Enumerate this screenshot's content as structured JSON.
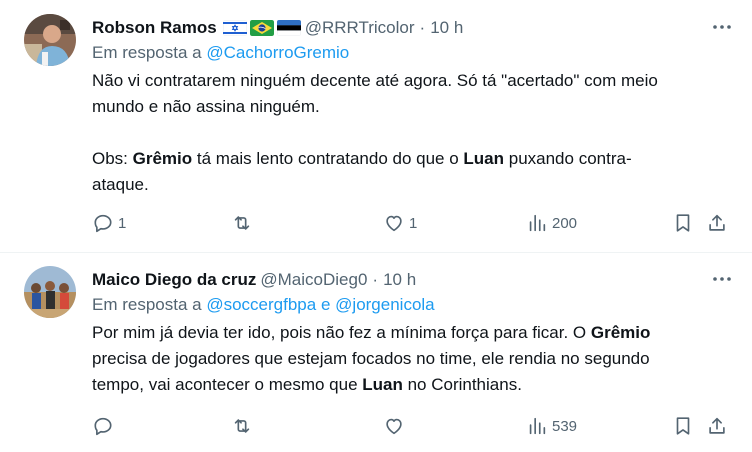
{
  "tweets": [
    {
      "author": "Robson Ramos",
      "flags": [
        "israel-flag",
        "brazil-flag",
        "estonia-flag"
      ],
      "handle": "@RRRTricolor",
      "dot": "·",
      "time": "10 h",
      "reply_prefix": "Em resposta a",
      "reply_mentions": [
        "@CachorroGremio"
      ],
      "text_p1_l1": "Não vi contratarem ninguém decente até agora. Só tá \"acertado\" com meio",
      "text_p1_l2": "mundo e não assina ninguém.",
      "text_p2_a": "Obs: ",
      "text_p2_b": "Grêmio",
      "text_p2_c": " tá mais lento contratando do que o ",
      "text_p2_d": "Luan",
      "text_p2_e": " puxando contra-",
      "text_p2_l2": "ataque.",
      "replies": "1",
      "retweets": "",
      "likes": "1",
      "views": "200"
    },
    {
      "author": "Maico Diego da cruz",
      "handle": "@MaicoDieg0",
      "dot": "·",
      "time": "10 h",
      "reply_prefix": "Em resposta a",
      "reply_mentions": [
        "@soccergfbpa",
        "@jorgenicola"
      ],
      "reply_joiner": "e",
      "text_l1_a": "Por mim já devia ter ido, pois não fez a mínima força para ficar. O ",
      "text_l1_b": "Grêmio",
      "text_l2": "precisa de jogadores que estejam focados no time, ele rendia no segundo",
      "text_l3_a": "tempo, vai acontecer o mesmo que ",
      "text_l3_b": "Luan",
      "text_l3_c": " no Corinthians.",
      "replies": "",
      "retweets": "",
      "likes": "",
      "views": "539"
    }
  ],
  "colors": {
    "text": "#0f1419",
    "secondary": "#536471",
    "link": "#1d9bf0",
    "divider": "#eff3f4"
  }
}
